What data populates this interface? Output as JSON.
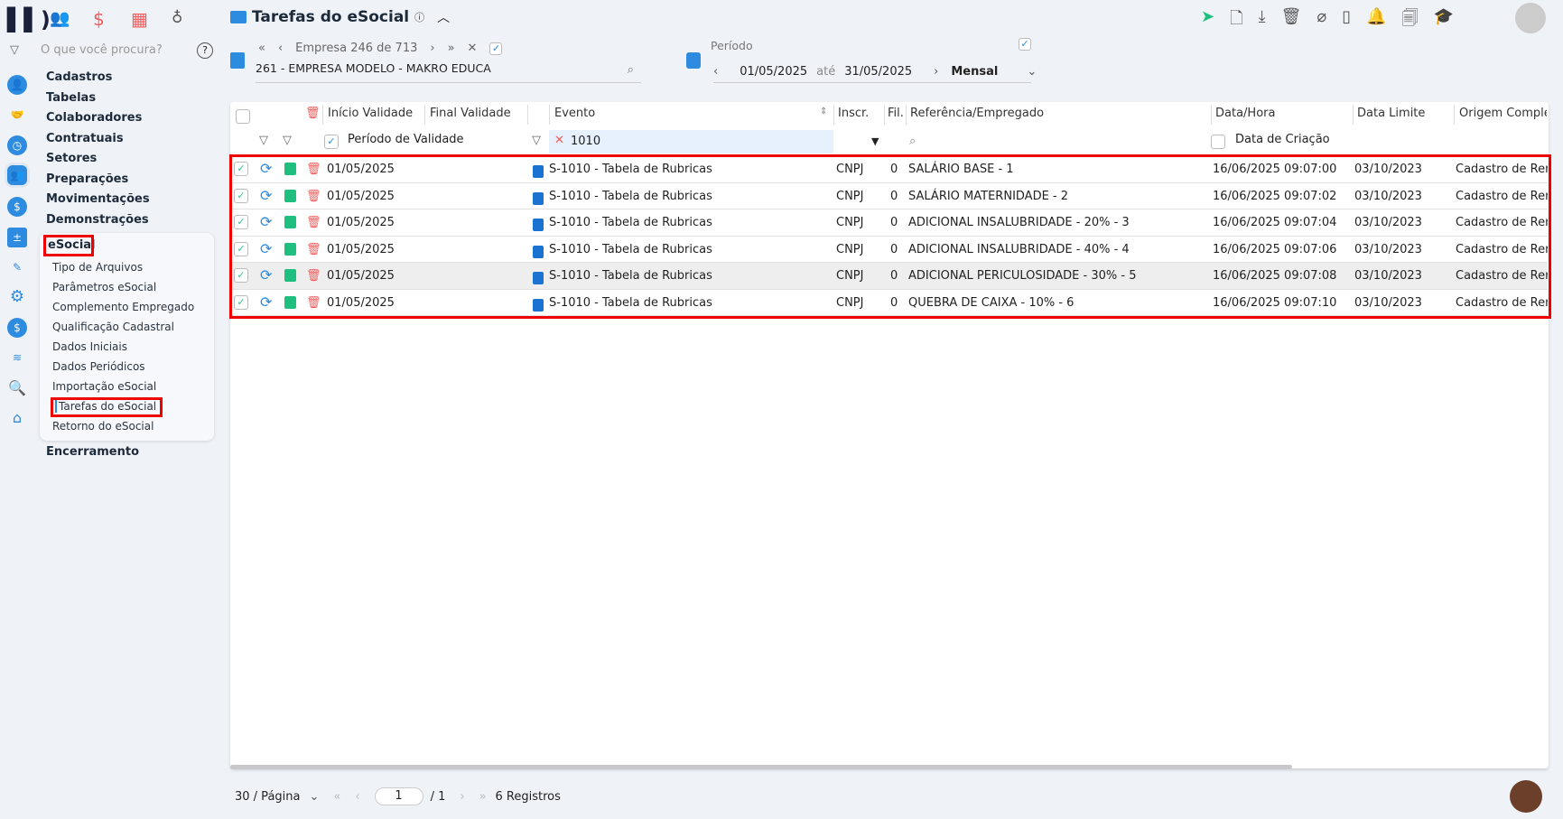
{
  "title": "Tarefas do eSocial",
  "search_placeholder": "O que você procura?",
  "menu": [
    "Cadastros",
    "Tabelas",
    "Colaboradores",
    "Contratuais",
    "Setores",
    "Preparações",
    "Movimentações",
    "Demonstrações"
  ],
  "esocial": {
    "label": "eSocial",
    "items": [
      "Tipo de Arquivos",
      "Parâmetros eSocial",
      "Complemento Empregado",
      "Qualificação Cadastral",
      "Dados Iniciais",
      "Dados Periódicos",
      "Importação eSocial",
      "Tarefas do eSocial",
      "Retorno do eSocial"
    ]
  },
  "menu_last": "Encerramento",
  "company": {
    "nav": "Empresa 246 de 713",
    "name": "261 - EMPRESA MODELO - MAKRO EDUCA"
  },
  "period": {
    "label": "Período",
    "from": "01/05/2025",
    "sep": "até",
    "to": "31/05/2025",
    "mode": "Mensal"
  },
  "table": {
    "headers": {
      "inicio": "Início Validade",
      "final": "Final Validade",
      "evento": "Evento",
      "inscr": "Inscr.",
      "fil": "Fil.",
      "ref": "Referência/Empregado",
      "datahora": "Data/Hora",
      "limite": "Data Limite",
      "origem": "Origem Comple"
    },
    "filters": {
      "periodo": "Período de Validade",
      "evento": "1010",
      "criacao": "Data de Criação"
    },
    "rows": [
      {
        "inicio": "01/05/2025",
        "evento": "S-1010 - Tabela de Rubricas",
        "inscr": "CNPJ",
        "fil": "0",
        "ref": "SALÁRIO BASE - 1",
        "datahora": "16/06/2025 09:07:00",
        "limite": "03/10/2023",
        "origem": "Cadastro de Rer"
      },
      {
        "inicio": "01/05/2025",
        "evento": "S-1010 - Tabela de Rubricas",
        "inscr": "CNPJ",
        "fil": "0",
        "ref": "SALÁRIO MATERNIDADE - 2",
        "datahora": "16/06/2025 09:07:02",
        "limite": "03/10/2023",
        "origem": "Cadastro de Rer"
      },
      {
        "inicio": "01/05/2025",
        "evento": "S-1010 - Tabela de Rubricas",
        "inscr": "CNPJ",
        "fil": "0",
        "ref": "ADICIONAL INSALUBRIDADE - 20% - 3",
        "datahora": "16/06/2025 09:07:04",
        "limite": "03/10/2023",
        "origem": "Cadastro de Rer"
      },
      {
        "inicio": "01/05/2025",
        "evento": "S-1010 - Tabela de Rubricas",
        "inscr": "CNPJ",
        "fil": "0",
        "ref": "ADICIONAL INSALUBRIDADE - 40% - 4",
        "datahora": "16/06/2025 09:07:06",
        "limite": "03/10/2023",
        "origem": "Cadastro de Rer"
      },
      {
        "inicio": "01/05/2025",
        "evento": "S-1010 - Tabela de Rubricas",
        "inscr": "CNPJ",
        "fil": "0",
        "ref": "ADICIONAL PERICULOSIDADE - 30% - 5",
        "datahora": "16/06/2025 09:07:08",
        "limite": "03/10/2023",
        "origem": "Cadastro de Rer"
      },
      {
        "inicio": "01/05/2025",
        "evento": "S-1010 - Tabela de Rubricas",
        "inscr": "CNPJ",
        "fil": "0",
        "ref": "QUEBRA DE CAIXA - 10% - 6",
        "datahora": "16/06/2025 09:07:10",
        "limite": "03/10/2023",
        "origem": "Cadastro de Rer"
      }
    ]
  },
  "footer": {
    "per_page": "30 / Página",
    "page": "1",
    "total_pages": "/ 1",
    "records": "6 Registros"
  }
}
